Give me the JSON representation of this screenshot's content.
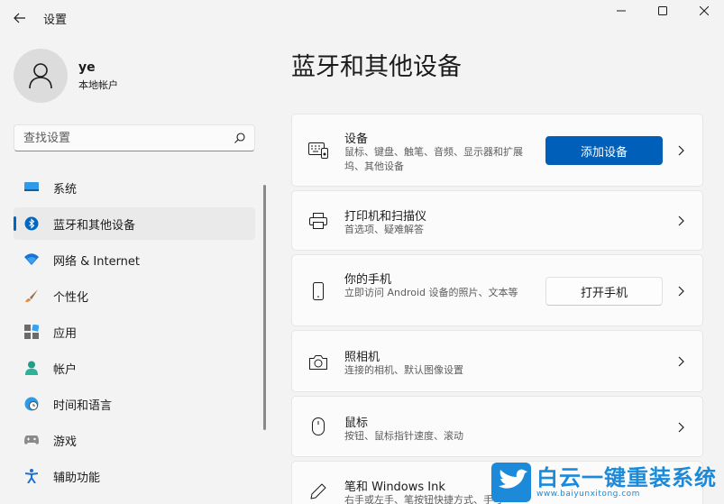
{
  "window": {
    "app_title": "设置",
    "controls": [
      "minimize-icon",
      "maximize-icon",
      "close-icon"
    ]
  },
  "profile": {
    "name": "ye",
    "account_type": "本地帐户"
  },
  "search": {
    "placeholder": "查找设置",
    "value": ""
  },
  "sidebar": {
    "items": [
      {
        "label": "系统",
        "icon": "display-icon",
        "active": false
      },
      {
        "label": "蓝牙和其他设备",
        "icon": "bluetooth-icon",
        "active": true
      },
      {
        "label": "网络 & Internet",
        "icon": "wifi-icon",
        "active": false
      },
      {
        "label": "个性化",
        "icon": "brush-icon",
        "active": false
      },
      {
        "label": "应用",
        "icon": "apps-icon",
        "active": false
      },
      {
        "label": "帐户",
        "icon": "person-icon",
        "active": false
      },
      {
        "label": "时间和语言",
        "icon": "globe-clock-icon",
        "active": false
      },
      {
        "label": "游戏",
        "icon": "gamepad-icon",
        "active": false
      },
      {
        "label": "辅助功能",
        "icon": "accessibility-icon",
        "active": false
      }
    ]
  },
  "main": {
    "title": "蓝牙和其他设备",
    "cards": [
      {
        "title": "设备",
        "subtitle": "鼠标、键盘、触笔、音频、显示器和扩展坞、其他设备",
        "icon": "devices-icon",
        "button": "添加设备"
      },
      {
        "title": "打印机和扫描仪",
        "subtitle": "首选项、疑难解答",
        "icon": "printer-icon"
      },
      {
        "title": "你的手机",
        "subtitle": "立即访问 Android 设备的照片、文本等",
        "icon": "phone-icon",
        "button": "打开手机"
      },
      {
        "title": "照相机",
        "subtitle": "连接的相机、默认图像设置",
        "icon": "camera-icon"
      },
      {
        "title": "鼠标",
        "subtitle": "按钮、鼠标指针速度、滚动",
        "icon": "mouse-icon"
      },
      {
        "title": "笔和 Windows Ink",
        "subtitle": "右手或左手、笔按钮快捷方式、手写",
        "icon": "pen-icon"
      }
    ]
  },
  "watermark": {
    "title": "白云一键重装系统",
    "url": "www.baiyunxitong.com"
  },
  "colors": {
    "accent": "#005fb8",
    "background": "#f3f3f3",
    "card": "#fbfbfb",
    "watermark": "#1c8ad8"
  }
}
